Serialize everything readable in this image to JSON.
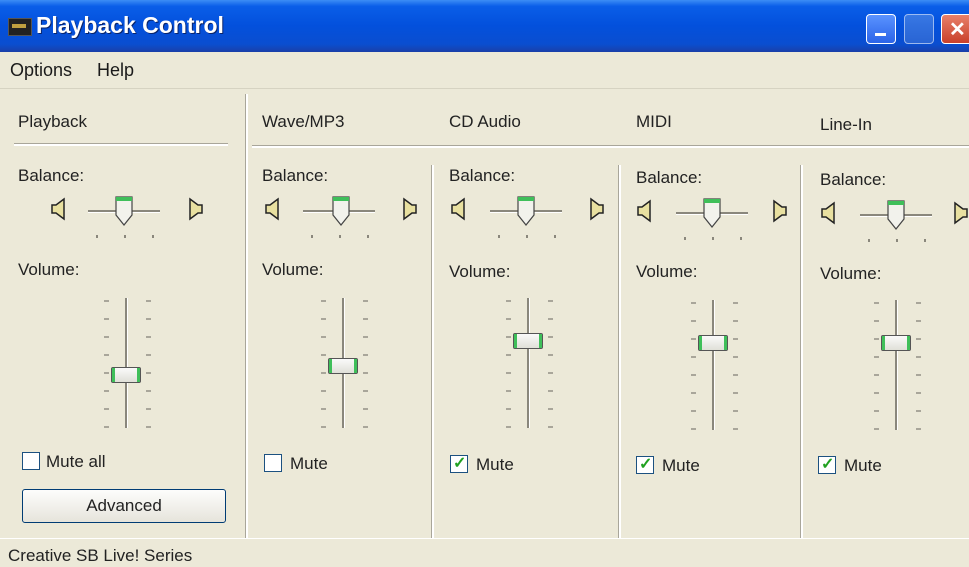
{
  "window": {
    "title": "Playback Control",
    "controls": [
      "minimize-icon",
      "maximize-icon",
      "close-icon"
    ]
  },
  "menu": {
    "items": [
      "Options",
      "Help"
    ]
  },
  "master": {
    "title": "Playback",
    "balance_label": "Balance:",
    "volume_label": "Volume:",
    "balance": 0.5,
    "volume": 0.4,
    "mute_label": "Mute all",
    "mute_checked": false,
    "advanced_label": "Advanced"
  },
  "channels": [
    {
      "name": "Wave/MP3",
      "balance_label": "Balance:",
      "volume_label": "Volume:",
      "balance": 0.5,
      "volume": 0.48,
      "mute_label": "Mute",
      "mute_checked": false
    },
    {
      "name": "CD Audio",
      "balance_label": "Balance:",
      "volume_label": "Volume:",
      "balance": 0.5,
      "volume": 0.68,
      "mute_label": "Mute",
      "mute_checked": true
    },
    {
      "name": "MIDI",
      "balance_label": "Balance:",
      "volume_label": "Volume:",
      "balance": 0.5,
      "volume": 0.68,
      "mute_label": "Mute",
      "mute_checked": true
    },
    {
      "name": "Line-In",
      "balance_label": "Balance:",
      "volume_label": "Volume:",
      "balance": 0.5,
      "volume": 0.68,
      "mute_label": "Mute",
      "mute_checked": true
    }
  ],
  "status": {
    "text": "Creative SB Live! Series"
  },
  "colors": {
    "title_bar": "#0350dc",
    "thumb_accent": "#3fbf5a",
    "check_mark": "#21a121",
    "face": "#ece9d8"
  },
  "icons": {
    "left_speaker": "speaker-left-icon",
    "right_speaker": "speaker-right-icon"
  }
}
